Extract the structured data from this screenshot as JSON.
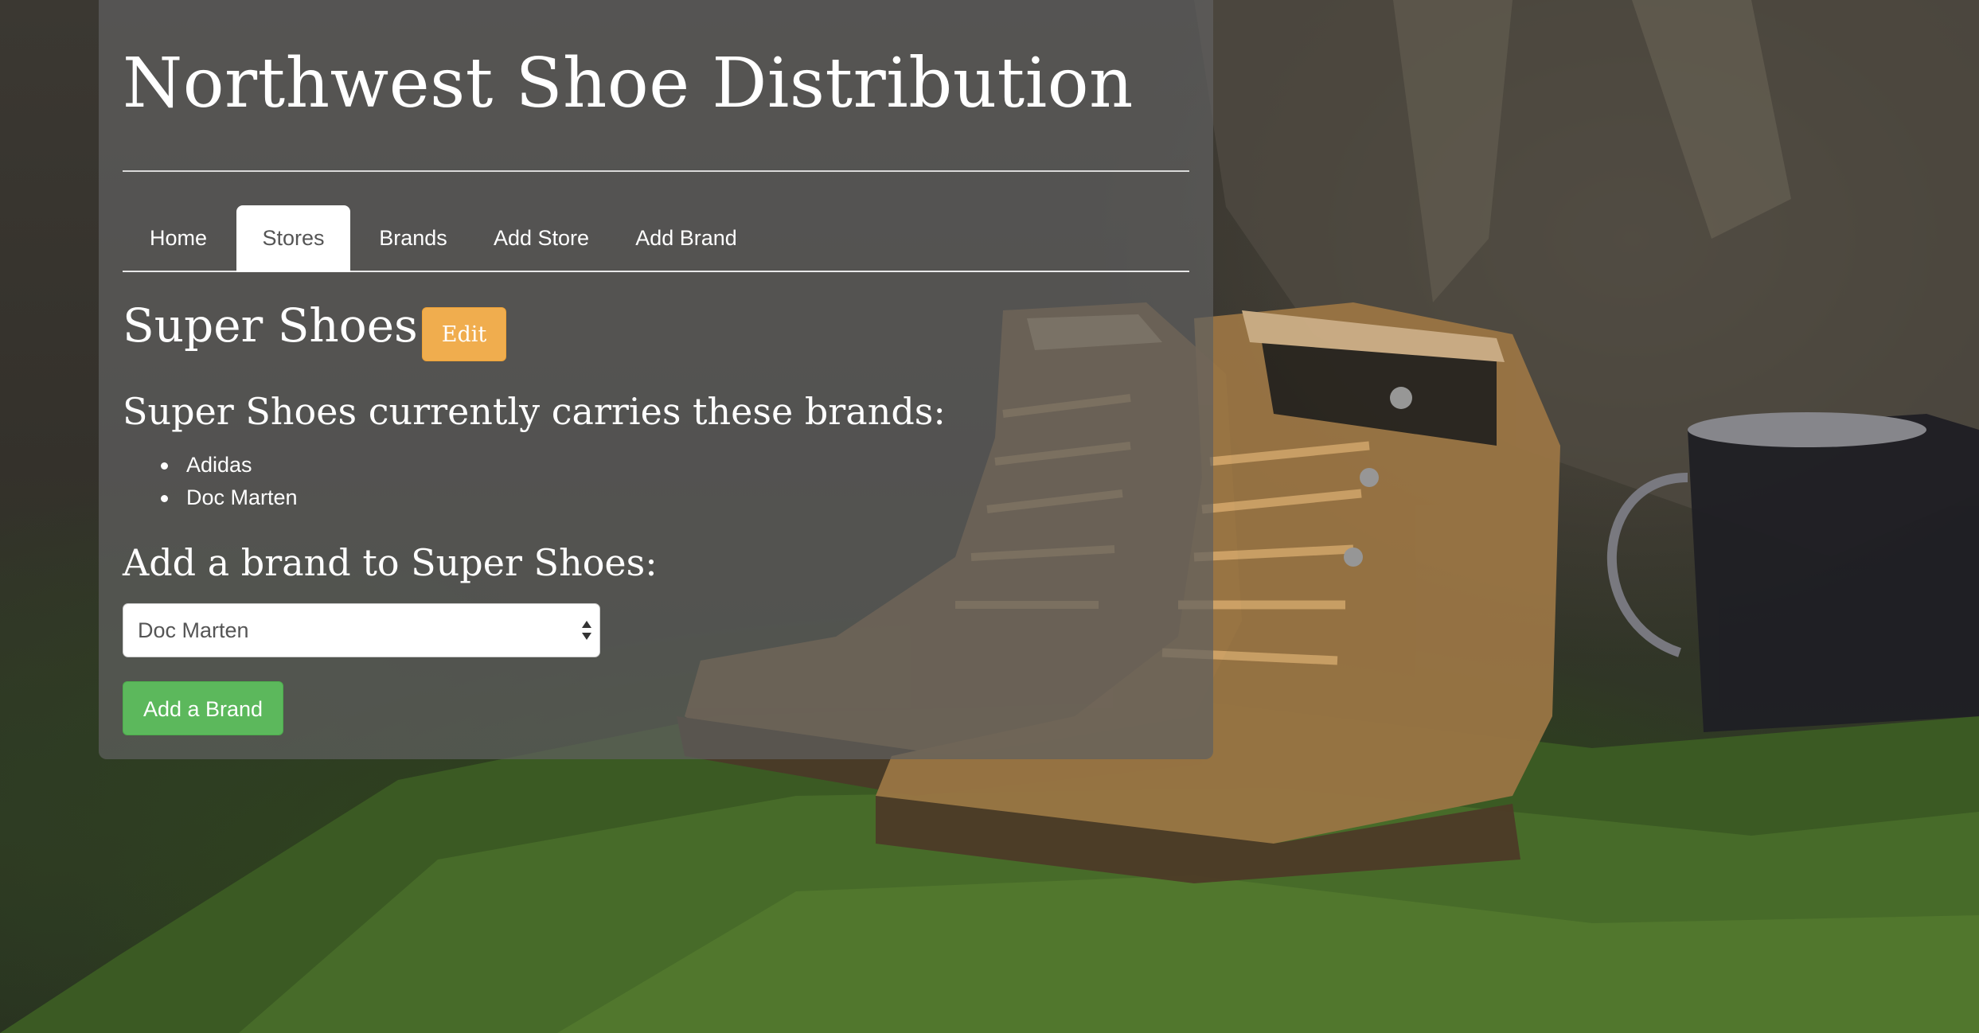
{
  "site": {
    "title": "Northwest Shoe Distribution"
  },
  "nav": {
    "tabs": [
      {
        "label": "Home",
        "active": false
      },
      {
        "label": "Stores",
        "active": true
      },
      {
        "label": "Brands",
        "active": false
      },
      {
        "label": "Add Store",
        "active": false
      },
      {
        "label": "Add Brand",
        "active": false
      }
    ]
  },
  "store": {
    "name": "Super Shoes",
    "edit_label": "Edit",
    "carries_heading": "Super Shoes currently carries these brands:",
    "brands": [
      "Adidas",
      "Doc Marten"
    ],
    "add_heading": "Add a brand to Super Shoes:",
    "select": {
      "selected": "Doc Marten"
    },
    "add_button_label": "Add a Brand"
  },
  "colors": {
    "panel": "#5f5f5f",
    "edit_button": "#f0ad4e",
    "add_button": "#5cb85c",
    "active_tab_bg": "#ffffff",
    "active_tab_text": "#555555"
  },
  "icons": {
    "select_arrows": "select-arrows-icon",
    "list_bullet": "bullet-icon"
  }
}
